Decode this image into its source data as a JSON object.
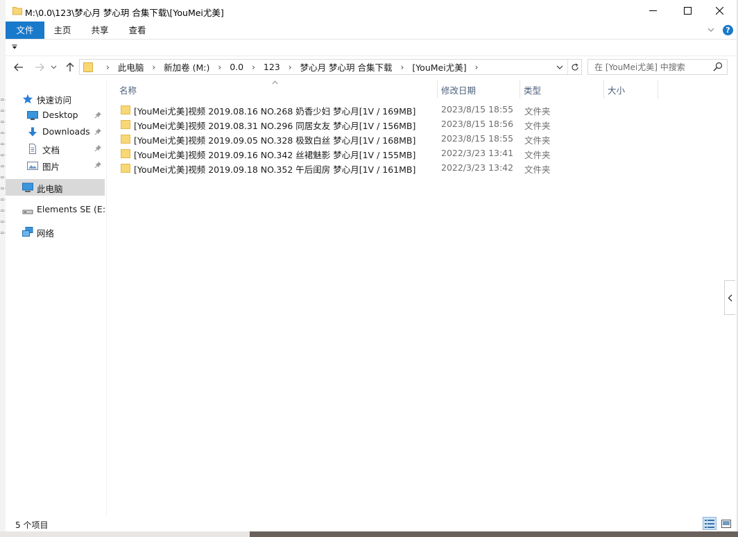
{
  "window": {
    "title": "M:\\0.0\\123\\梦心月 梦心玥 合集下载\\[YouMei尤美]"
  },
  "ribbon": {
    "tabs": [
      "文件",
      "主页",
      "共享",
      "查看"
    ],
    "help": "?"
  },
  "address": {
    "crumbs": [
      "此电脑",
      "新加卷 (M:)",
      "0.0",
      "123",
      "梦心月 梦心玥 合集下载",
      "[YouMei尤美]"
    ]
  },
  "search": {
    "placeholder": "在 [YouMei尤美] 中搜索"
  },
  "sidebar": {
    "items": [
      {
        "label": "快速访问",
        "icon": "star-icon"
      },
      {
        "label": "Desktop",
        "icon": "desktop-icon",
        "pinned": true
      },
      {
        "label": "Downloads",
        "icon": "download-icon",
        "pinned": true
      },
      {
        "label": "文档",
        "icon": "document-icon",
        "pinned": true
      },
      {
        "label": "图片",
        "icon": "picture-icon",
        "pinned": true
      },
      {
        "label": "此电脑",
        "icon": "computer-icon",
        "selected": true
      },
      {
        "label": "Elements SE (E:)",
        "icon": "drive-icon"
      },
      {
        "label": "网络",
        "icon": "network-icon"
      }
    ]
  },
  "list": {
    "headers": {
      "name": "名称",
      "date": "修改日期",
      "type": "类型",
      "size": "大小"
    },
    "rows": [
      {
        "name": "[YouMei尤美]视频 2019.08.16 NO.268 奶香少妇 梦心月[1V / 169MB]",
        "date": "2023/8/15 18:55",
        "type": "文件夹"
      },
      {
        "name": "[YouMei尤美]视频 2019.08.31 NO.296 同居女友 梦心月[1V / 156MB]",
        "date": "2023/8/15 18:56",
        "type": "文件夹"
      },
      {
        "name": "[YouMei尤美]视频 2019.09.05 NO.328 极致白丝 梦心月[1V / 168MB]",
        "date": "2023/8/15 18:55",
        "type": "文件夹"
      },
      {
        "name": "[YouMei尤美]视频 2019.09.16 NO.342 丝裙魅影 梦心月[1V / 155MB]",
        "date": "2022/3/23 13:41",
        "type": "文件夹"
      },
      {
        "name": "[YouMei尤美]视频 2019.09.18 NO.352 午后闺房 梦心月[1V / 161MB]",
        "date": "2022/3/23 13:42",
        "type": "文件夹"
      }
    ]
  },
  "status": {
    "count": "5 个项目"
  },
  "colors": {
    "accent": "#1979ca",
    "folder": "#f8d775",
    "selected_bg": "#d9d9d9",
    "header_text": "#4c607a"
  }
}
